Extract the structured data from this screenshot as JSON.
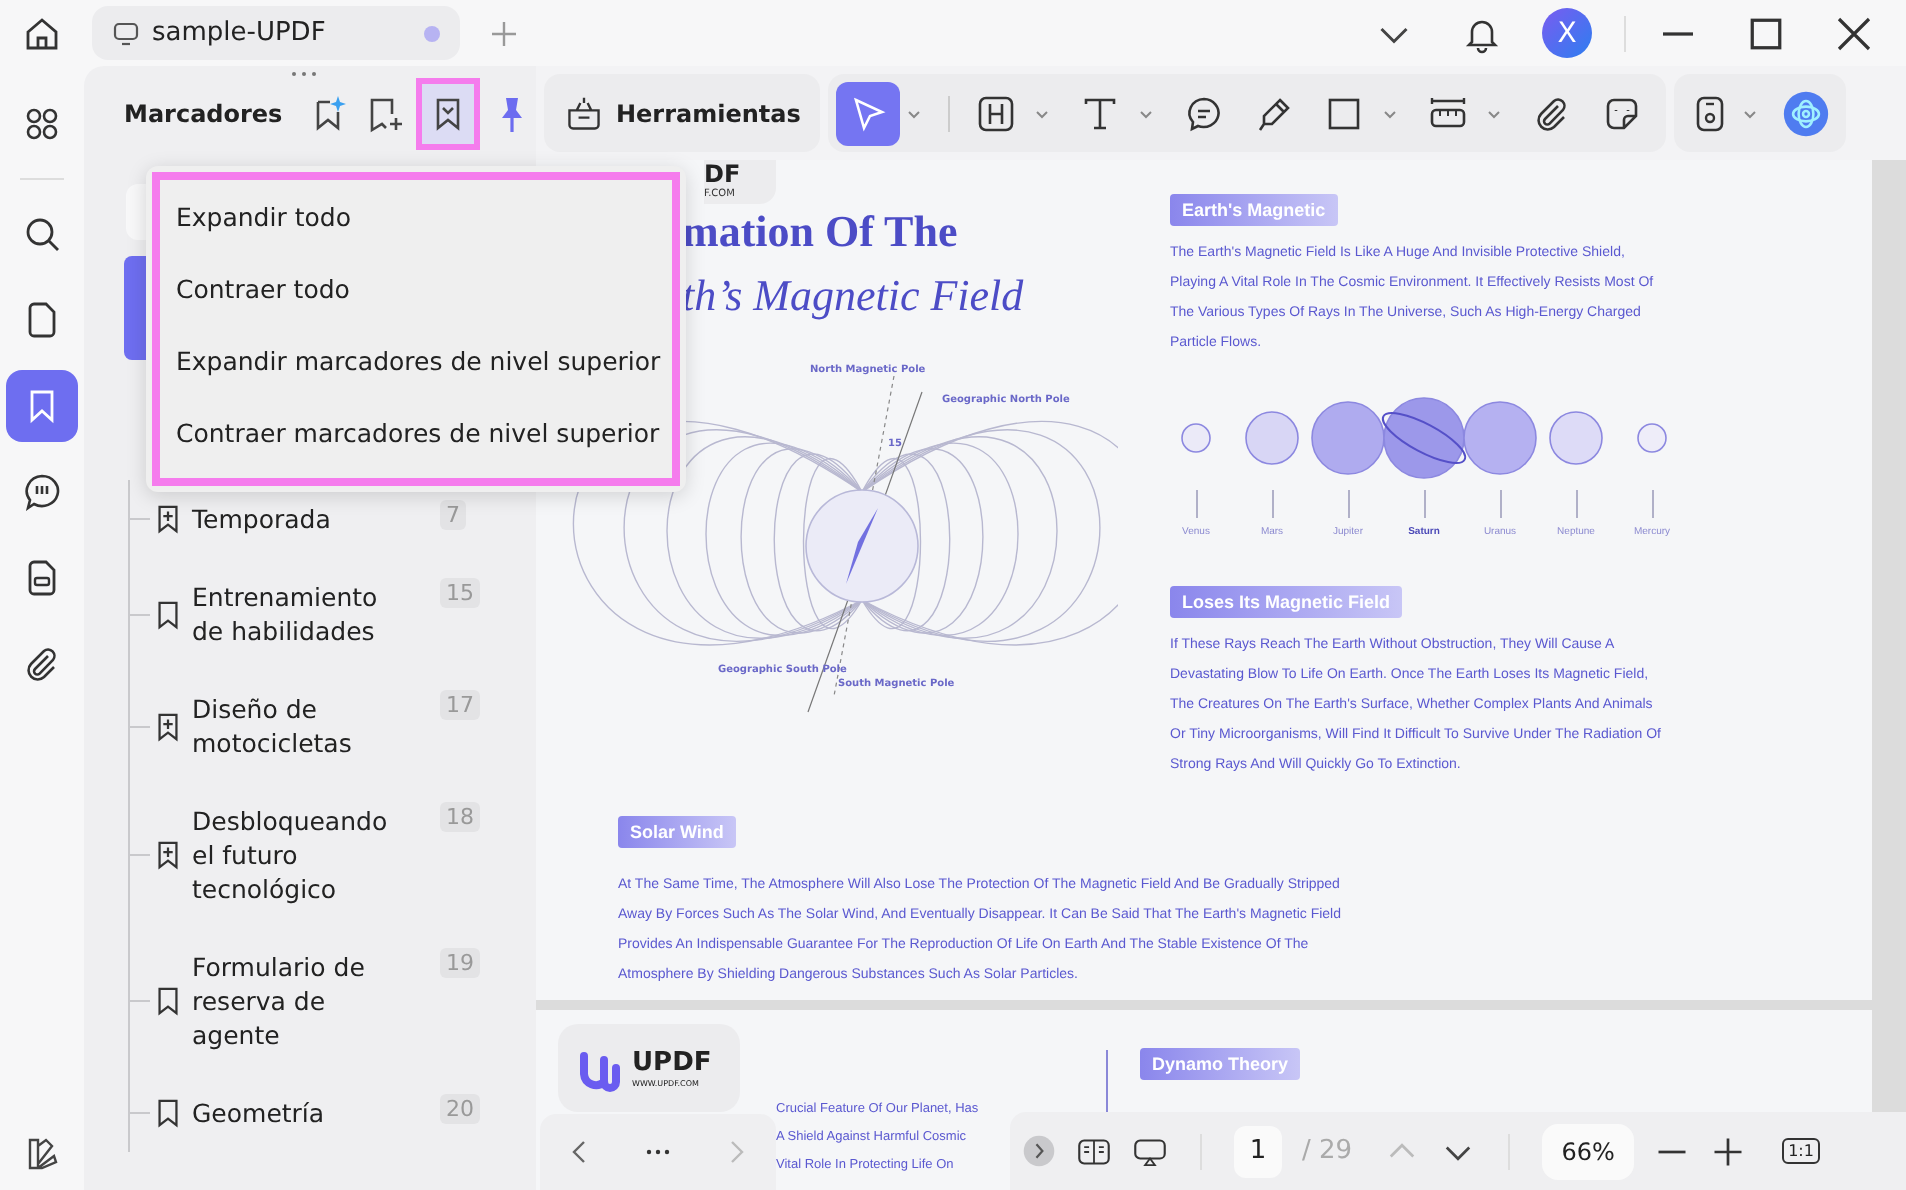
{
  "tab": {
    "title": "sample-UPDF",
    "unsaved": true
  },
  "window": {
    "avatar": "X"
  },
  "rail": {
    "items": [
      {
        "kind": "thumbnails",
        "selected": false
      },
      {
        "kind": "search",
        "selected": false
      },
      {
        "kind": "pages",
        "selected": false
      },
      {
        "kind": "bookmarks",
        "selected": true
      },
      {
        "kind": "comments",
        "selected": false
      },
      {
        "kind": "forms",
        "selected": false
      },
      {
        "kind": "attachments",
        "selected": false
      }
    ]
  },
  "sidebar": {
    "title": "Marcadores",
    "tools": [
      {
        "kind": "ai-add",
        "selected": false
      },
      {
        "kind": "add",
        "selected": false
      },
      {
        "kind": "collapse",
        "selected": true
      },
      {
        "kind": "pin",
        "selected": false
      }
    ],
    "bookmarks": [
      {
        "label": "Temporada",
        "page": "7",
        "has_children": true
      },
      {
        "label": "Entrenamiento de habilidades",
        "page": "15",
        "has_children": false
      },
      {
        "label": "Diseño de motocicletas",
        "page": "17",
        "has_children": true
      },
      {
        "label": "Desbloqueando el futuro tecnológico",
        "page": "18",
        "has_children": true
      },
      {
        "label": "Formulario de reserva de agente",
        "page": "19",
        "has_children": false
      },
      {
        "label": "Geometría",
        "page": "20",
        "has_children": false
      }
    ]
  },
  "menu": {
    "items": [
      "Expandir todo",
      "Contraer todo",
      "Expandir marcadores de nivel superior",
      "Contraer marcadores de nivel superior"
    ]
  },
  "toolbar": {
    "tools_label": "Herramientas",
    "tools": [
      {
        "kind": "select",
        "selected": true,
        "dropdown": true
      },
      {
        "kind": "text-box",
        "selected": false,
        "dropdown": true
      },
      {
        "kind": "text",
        "selected": false,
        "dropdown": true
      },
      {
        "kind": "comment",
        "selected": false,
        "dropdown": false
      },
      {
        "kind": "pen",
        "selected": false,
        "dropdown": false
      },
      {
        "kind": "shape",
        "selected": false,
        "dropdown": true
      },
      {
        "kind": "measure",
        "selected": false,
        "dropdown": true
      },
      {
        "kind": "attach",
        "selected": false,
        "dropdown": false
      },
      {
        "kind": "sticker",
        "selected": false,
        "dropdown": false
      }
    ]
  },
  "page1": {
    "logo_visible": {
      "wordmark": "DF",
      "url": "F.COM"
    },
    "title": "mation Of The",
    "subtitle": "th’s Magnetic Field",
    "diagram_labels": [
      {
        "kind": "north-magnetic",
        "text": "North Magnetic Pole"
      },
      {
        "kind": "north-geographic",
        "text": "Geographic North Pole"
      },
      {
        "kind": "angle",
        "text": "15"
      },
      {
        "kind": "south-geographic",
        "text": "Geographic South Pole"
      },
      {
        "kind": "south-magnetic",
        "text": "South Magnetic Pole"
      }
    ],
    "sections": [
      {
        "tag": "Earth's Magnetic",
        "text": "The Earth's Magnetic Field Is Like A Huge And Invisible Protective Shield, Playing A Vital Role In The Cosmic Environment. It Effectively Resists Most Of The Various Types Of Rays In The Universe, Such As High-Energy Charged Particle Flows."
      },
      {
        "tag": "Loses Its Magnetic Field",
        "text": "If These Rays Reach The Earth Without Obstruction, They Will Cause A Devastating Blow To Life On Earth. Once The Earth Loses Its Magnetic Field, The Creatures On The Earth's Surface, Whether Complex Plants And Animals Or Tiny Microorganisms, Will Find It Difficult To Survive Under The Radiation Of Strong Rays And Will Quickly Go To Extinction."
      },
      {
        "tag": "Solar Wind",
        "text": "At The Same Time, The Atmosphere Will Also Lose The Protection Of The Magnetic Field And Be Gradually Stripped Away By Forces Such As The Solar Wind, And Eventually Disappear. It Can Be Said That The Earth's Magnetic Field Provides An Indispensable Guarantee For The Reproduction Of Life On Earth And The Stable Existence Of The Atmosphere By Shielding Dangerous Substances Such As Solar Particles."
      }
    ],
    "planets": [
      {
        "name": "Venus",
        "kind": "small",
        "color": "#ebeaf8"
      },
      {
        "name": "Mars",
        "kind": "medium",
        "color": "#d8d6f5"
      },
      {
        "name": "Jupiter",
        "kind": "large",
        "color": "#afabef"
      },
      {
        "name": "Saturn",
        "kind": "ringed",
        "color": "#9c98ea"
      },
      {
        "name": "Uranus",
        "kind": "large",
        "color": "#b5b1f1"
      },
      {
        "name": "Neptune",
        "kind": "medium",
        "color": "#dddbf7"
      },
      {
        "name": "Mercury",
        "kind": "small",
        "color": "#eeedf9"
      }
    ]
  },
  "page2": {
    "logo": {
      "wordmark": "UPDF",
      "url": "WWW.UPDF.COM"
    },
    "lines": [
      "Crucial Feature Of Our Planet, Has",
      "A Shield Against Harmful Cosmic",
      "Vital Role In Protecting Life On"
    ],
    "tag": "Dynamo Theory"
  },
  "pager": {
    "page": "1",
    "total": "/ 29",
    "zoom": "66%",
    "fit": "1:1"
  }
}
